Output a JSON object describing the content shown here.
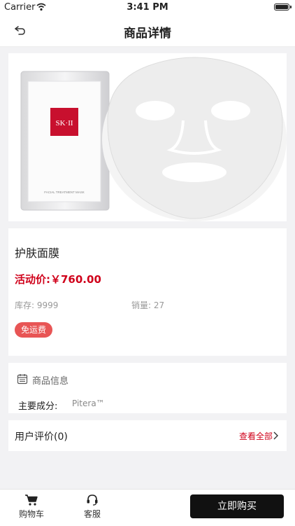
{
  "status_bar": {
    "carrier": "Carrier",
    "time": "3:41 PM"
  },
  "nav": {
    "title": "商品详情"
  },
  "product": {
    "image_alt": "SK-II 护肤面膜",
    "packet_brand": "SK·II",
    "packet_caption": "FACIAL TREATMENT MASK",
    "name": "护肤面膜",
    "price": "活动价:￥760.00",
    "stock": "库存: 9999",
    "sales": "销量: 27",
    "badge": "免运费"
  },
  "specs": {
    "heading": "商品信息",
    "rows": [
      {
        "label": "主要成分:",
        "value": "Pitera™"
      }
    ]
  },
  "reviews": {
    "label": "用户评价(0)",
    "more": "查看全部"
  },
  "tabbar": {
    "cart": "购物车",
    "service": "客服",
    "buy": "立即购买"
  },
  "colors": {
    "accent": "#d0021b",
    "badge": "#e85555",
    "buy_button": "#111111"
  }
}
